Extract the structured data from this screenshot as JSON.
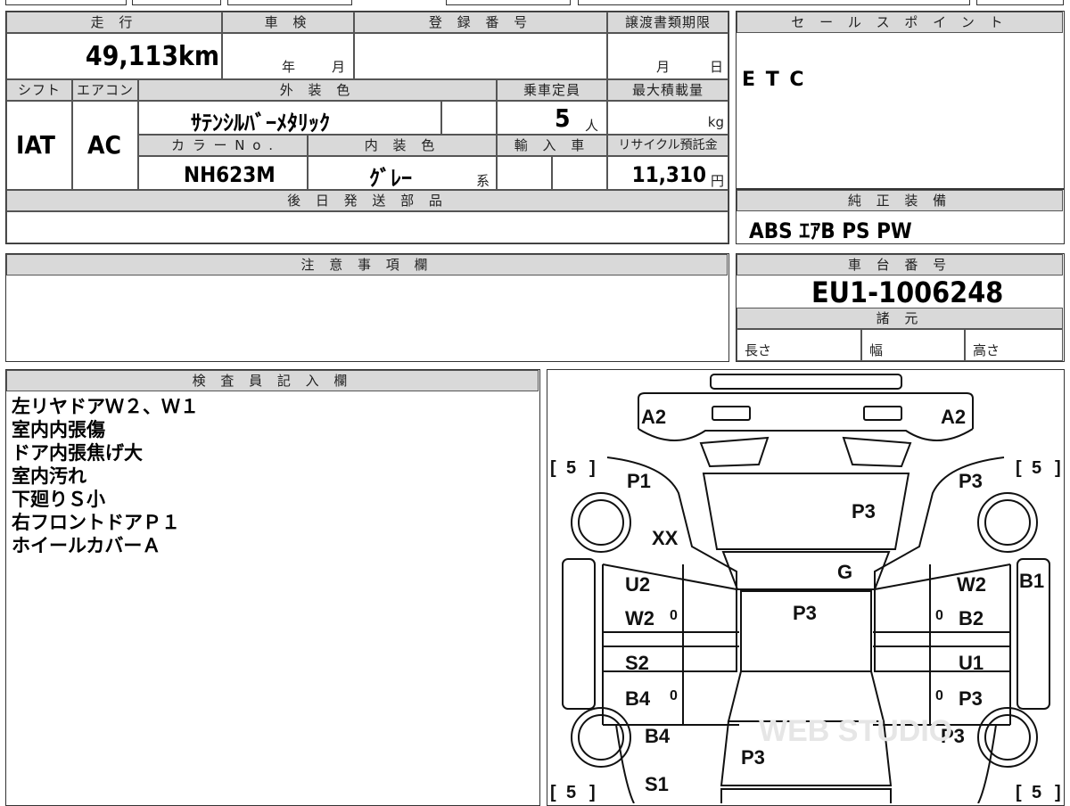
{
  "spec": {
    "mileage_label": "走 行",
    "mileage_value": "49,113",
    "mileage_unit": "km",
    "inspection_label": "車 検",
    "year_label": "年",
    "month_label": "月",
    "registration_label": "登 録 番 号",
    "transfer_label": "譲渡書類期限",
    "transfer_month": "月",
    "transfer_day": "日",
    "shift_label": "シフト",
    "shift_value": "IAT",
    "ac_label": "エアコン",
    "ac_value": "AC",
    "exterior_color_label": "外 装 色",
    "exterior_color_value": "ｻﾃﾝｼﾙﾊﾞｰﾒﾀﾘｯｸ",
    "capacity_label": "乗車定員",
    "capacity_value": "5",
    "capacity_unit": "人",
    "max_load_label": "最大積載量",
    "max_load_unit": "kg",
    "color_no_label": "カ ラ ー N o .",
    "color_no_value": "NH623M",
    "interior_color_label": "内 装 色",
    "interior_color_value": "ｸﾞﾚｰ",
    "interior_suffix": "系",
    "import_label": "輸 入 車",
    "recycle_label": "リサイクル預託金",
    "recycle_value": "11,310",
    "recycle_unit": "円",
    "later_parts_label": "後 日 発 送 部 品"
  },
  "sales": {
    "label": "セ ー ル ス ポ イ ン ト",
    "value": "E T C"
  },
  "equipment": {
    "label": "純 正 装 備",
    "value": "ABS ｴｱB PS PW"
  },
  "caution": {
    "label": "注 意 事 項 欄"
  },
  "chassis": {
    "label": "車 台 番 号",
    "value": "EU1-1006248"
  },
  "dimensions": {
    "label": "諸 元",
    "length": "長さ",
    "width": "幅",
    "height": "高さ"
  },
  "inspector": {
    "label": "検 査 員 記 入 欄",
    "notes": [
      "左リヤドアＷ２、Ｗ１",
      "室内内張傷",
      "ドア内張焦げ大",
      "室内汚れ",
      "下廻りＳ小",
      "右フロントドアＰ１",
      "ホイールカバーＡ"
    ]
  },
  "diagram": {
    "marks": {
      "front_left": "A2",
      "front_right": "A2",
      "fl_fender": "P1",
      "fr_fender": "P3",
      "hood": "P3",
      "fl_extra": "XX",
      "windshield": "G",
      "lf_door_top": "U2",
      "lf_door_bottom": "W2",
      "lr_door_top": "S2",
      "lr_door_bottom": "B4",
      "rf_door_top": "W2",
      "rf_door_bottom": "B2",
      "rr_door_top": "U1",
      "rr_door_bottom": "P3",
      "roof": "P3",
      "right_side": "B1",
      "rear_left": "B4",
      "rear_right": "P3",
      "trunk": "P3",
      "rear_sill": "S1",
      "zero": "0",
      "tire": "5",
      "bracket_open": "[",
      "bracket_close": "]",
      "watermark": "WEB STUDIO"
    }
  }
}
